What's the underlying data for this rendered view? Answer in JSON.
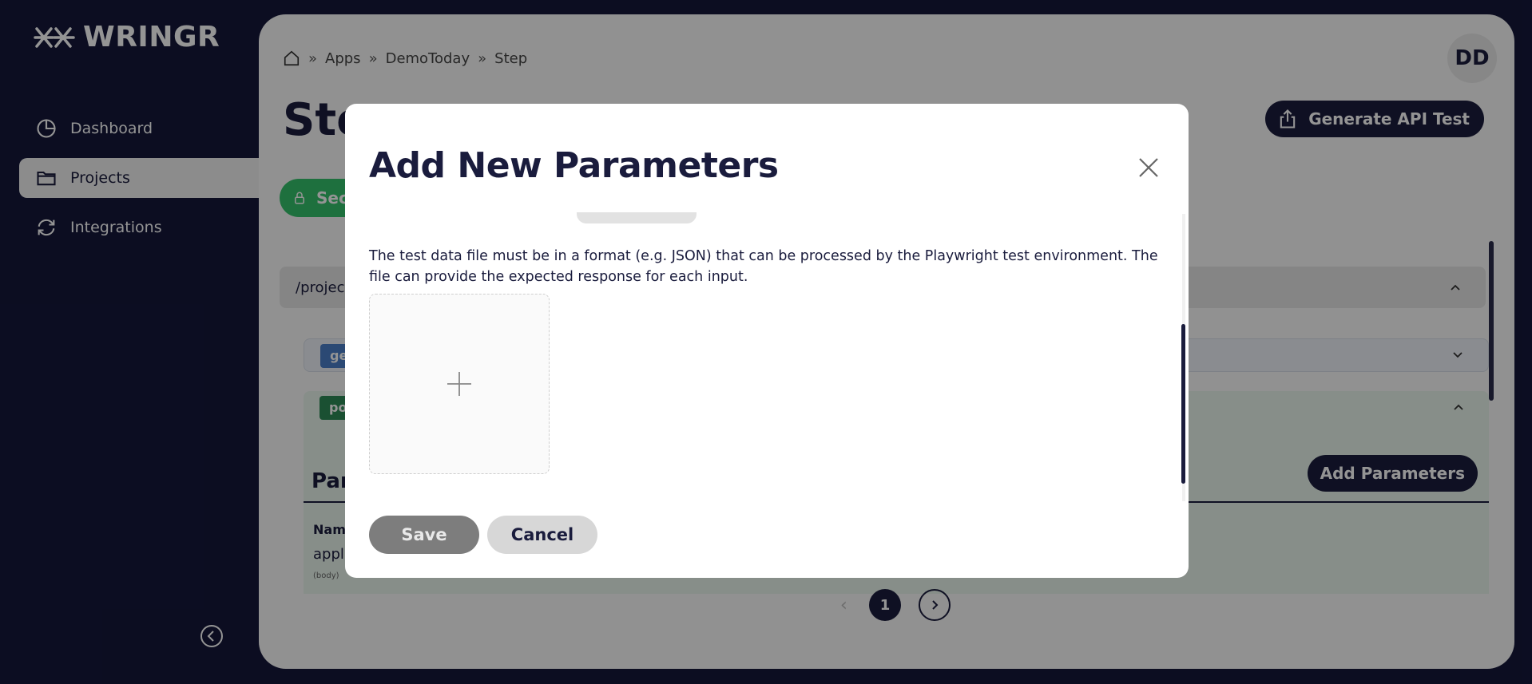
{
  "app": {
    "logo_text": "WRINGR"
  },
  "sidebar": {
    "items": [
      {
        "label": "Dashboard",
        "icon": "pie-chart-icon"
      },
      {
        "label": "Projects",
        "icon": "folder-icon"
      },
      {
        "label": "Integrations",
        "icon": "refresh-icon"
      }
    ],
    "active_index": 1
  },
  "header": {
    "breadcrumb": [
      "Apps",
      "DemoToday",
      "Step"
    ],
    "page_title": "Ste",
    "avatar_initials": "DD",
    "generate_api_test_label": "Generate API Test"
  },
  "content": {
    "secure_label": "Sec",
    "path_text": "/project",
    "get_tag": "ge",
    "post_tag": "po",
    "parameters_title": "Par",
    "add_parameters_label": "Add Parameters",
    "col_name": "Nam",
    "row_value": "appl",
    "row_sub": "(body)"
  },
  "pagination": {
    "prev_icon": "chevron-left-icon",
    "current_page": "1",
    "next_icon": "chevron-right-icon"
  },
  "modal": {
    "title": "Add New Parameters",
    "description": "The test data file must be in a format (e.g. JSON) that can be processed by the Playwright test environment. The file can provide the expected response for each input.",
    "upload_icon": "plus-icon",
    "save_label": "Save",
    "cancel_label": "Cancel"
  },
  "colors": {
    "navy": "#1a1c3d",
    "green": "#34c26b",
    "get_blue": "#4a7ec8",
    "post_green": "#2e8b57"
  }
}
